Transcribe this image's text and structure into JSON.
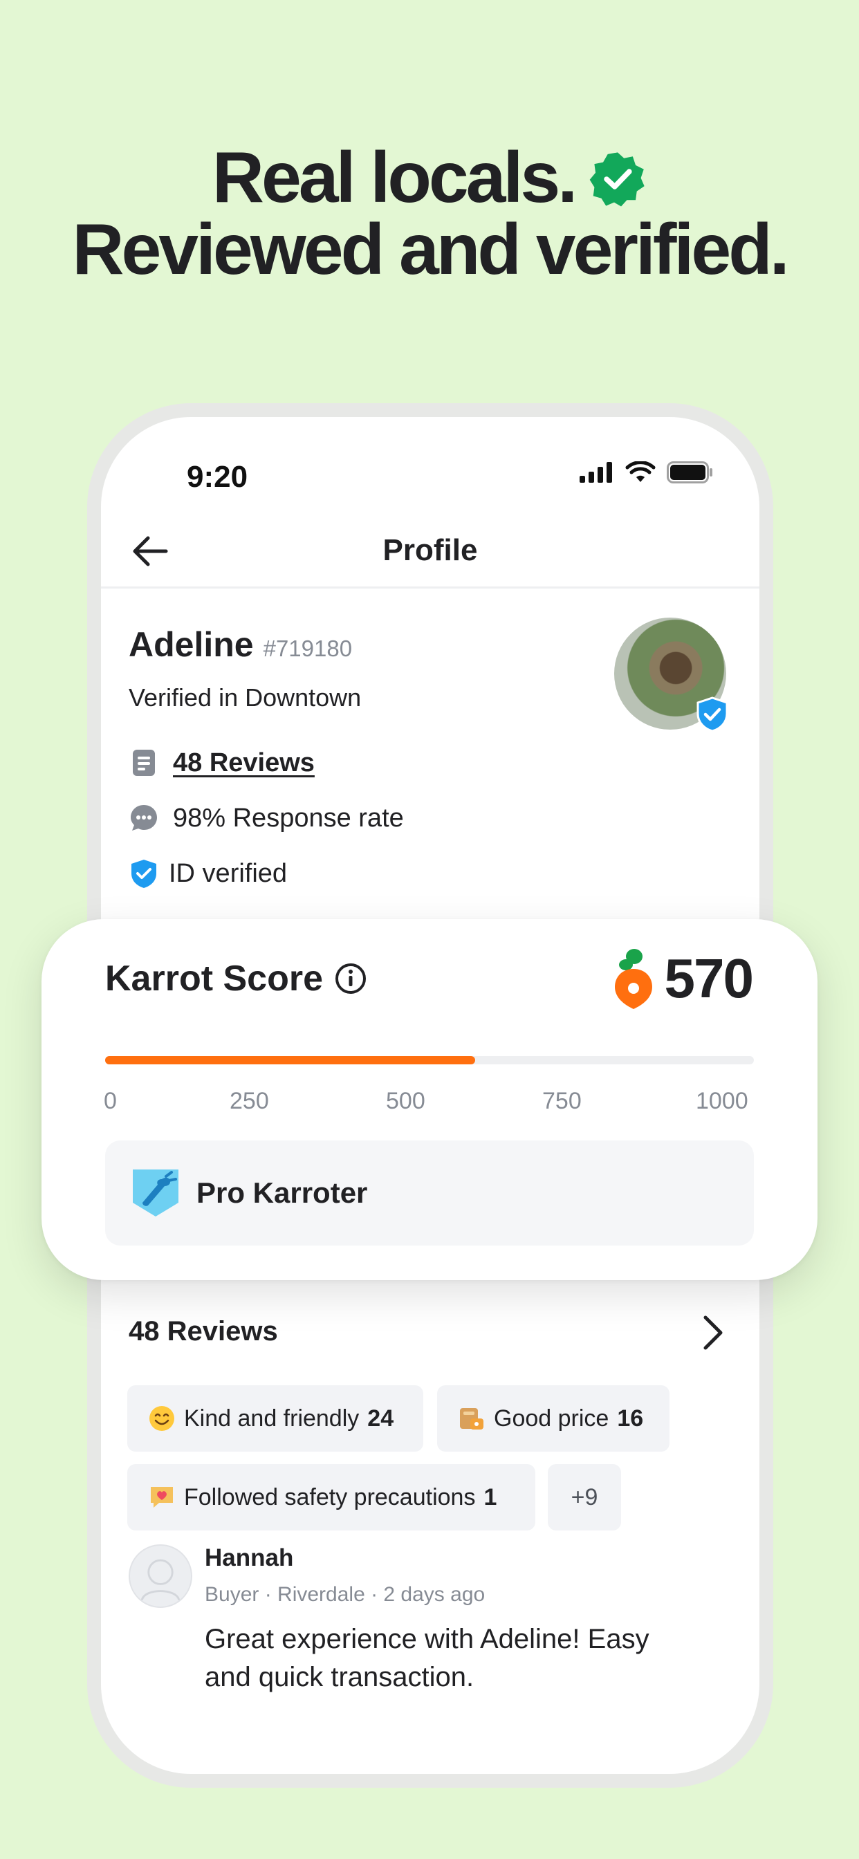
{
  "headline": {
    "line1": "Real locals.",
    "line2": "Reviewed and verified."
  },
  "status_bar": {
    "time": "9:20"
  },
  "nav": {
    "title": "Profile"
  },
  "profile": {
    "name": "Adeline",
    "id": "#719180",
    "verified_location": "Verified in Downtown",
    "reviews_link": "48 Reviews",
    "response_rate": "98% Response rate",
    "id_verified": "ID verified"
  },
  "karrot_score": {
    "title": "Karrot Score",
    "value": "570",
    "progress_value": 570,
    "progress_max": 1000,
    "ticks": [
      "0",
      "250",
      "500",
      "750",
      "1000"
    ],
    "tier": "Pro Karroter"
  },
  "reviews": {
    "header": "48 Reviews",
    "chips": [
      {
        "label": "Kind and friendly",
        "count": "24",
        "icon": "smile-emoji-icon"
      },
      {
        "label": "Good price",
        "count": "16",
        "icon": "price-tag-icon"
      },
      {
        "label": "Followed safety precautions",
        "count": "1",
        "icon": "heart-message-icon"
      },
      {
        "label": "+9",
        "count": ""
      }
    ],
    "review": {
      "author": "Hannah",
      "meta": "Buyer · Riverdale · 2 days ago",
      "text": "Great experience with Adeline! Easy and quick transaction."
    }
  },
  "colors": {
    "background": "#e3f7d3",
    "accent_orange": "#ff6f0f",
    "verified_blue": "#1e9bf0",
    "check_green": "#12a85a"
  }
}
